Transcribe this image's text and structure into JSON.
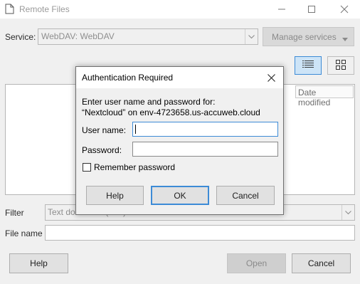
{
  "window": {
    "title": "Remote Files",
    "icons": {
      "app": "document-icon",
      "minimize": "minimize-icon",
      "maximize": "maximize-icon",
      "close": "close-icon"
    }
  },
  "service": {
    "label": "Service:",
    "value": "WebDAV: WebDAV",
    "manage_label": "Manage services"
  },
  "file_list": {
    "column_date": "Date modified"
  },
  "filter": {
    "label": "Filter",
    "value": "Text document (*.txt)"
  },
  "filename": {
    "label": "File name",
    "value": ""
  },
  "buttons": {
    "help": "Help",
    "open": "Open",
    "cancel": "Cancel"
  },
  "dialog": {
    "title": "Authentication Required",
    "message_line1": "Enter user name and password for:",
    "message_line2": "“Nextcloud” on env-4723658.us-accuweb.cloud",
    "username_label": "User name:",
    "username_value": "",
    "password_label": "Password:",
    "password_value": "",
    "remember_label": "Remember password",
    "remember_checked": false,
    "help": "Help",
    "ok": "OK",
    "cancel": "Cancel"
  },
  "colors": {
    "accent": "#3d8bd6",
    "window_bg": "#f0f0f0"
  }
}
